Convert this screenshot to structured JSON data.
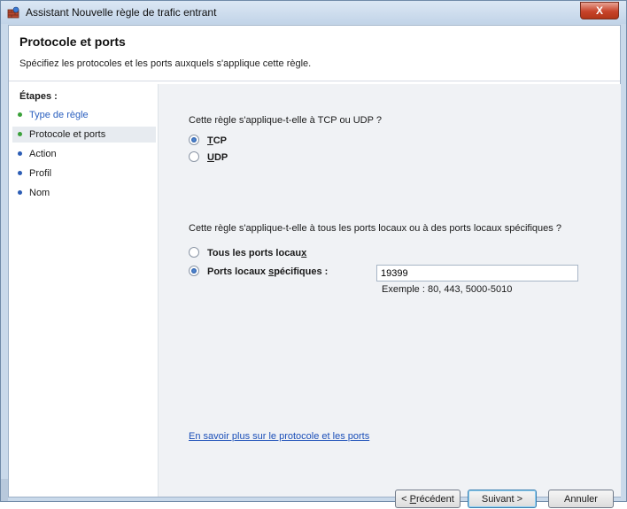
{
  "window": {
    "title": "Assistant Nouvelle règle de trafic entrant",
    "close_label": "X"
  },
  "header": {
    "title": "Protocole et ports",
    "subtitle": "Spécifiez les protocoles et les ports auxquels s'applique cette règle."
  },
  "sidebar": {
    "label": "Étapes :",
    "steps": [
      {
        "label": "Type de règle"
      },
      {
        "label": "Protocole et ports"
      },
      {
        "label": "Action"
      },
      {
        "label": "Profil"
      },
      {
        "label": "Nom"
      }
    ]
  },
  "main": {
    "protocol_question": "Cette règle s'applique-t-elle à TCP ou UDP ?",
    "tcp": {
      "first": "T",
      "rest": "CP"
    },
    "udp": {
      "first": "U",
      "rest": "DP"
    },
    "ports_question": "Cette règle s'applique-t-elle à tous les ports locaux ou à des ports locaux spécifiques ?",
    "all_ports": {
      "before": "Tous les ports locau",
      "key": "x",
      "after": ""
    },
    "specific_ports": {
      "before": "Ports locaux ",
      "key": "s",
      "after": "pécifiques :"
    },
    "port_value": "19399",
    "example": "Exemple : 80, 443, 5000-5010",
    "help_link": "En savoir plus sur le protocole et les ports"
  },
  "buttons": {
    "previous": {
      "key": "P",
      "rest": "récédent",
      "prefix": "< "
    },
    "next": "Suivant >",
    "cancel": "Annuler"
  },
  "colors": {
    "accent": "#2a5fbf",
    "link": "#1b4fb8",
    "close": "#c7432a"
  }
}
